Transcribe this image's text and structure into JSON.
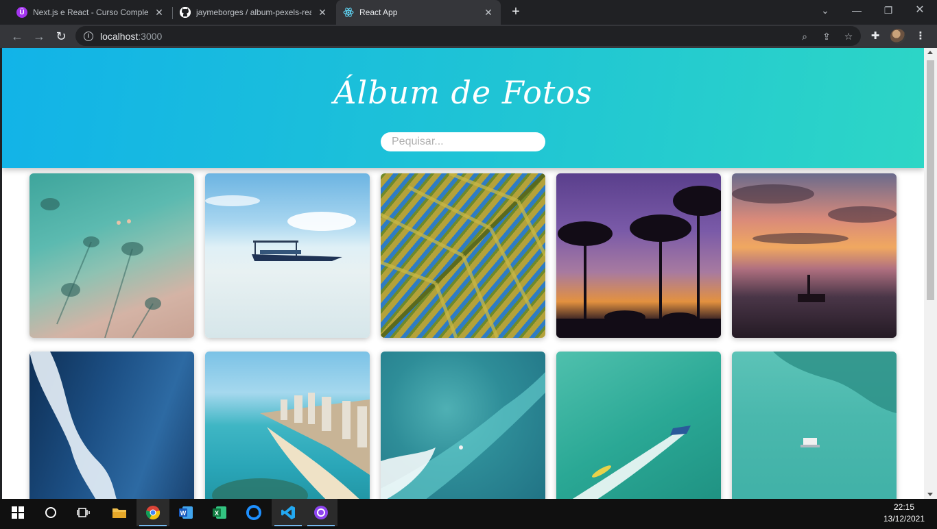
{
  "browser": {
    "tabs": [
      {
        "title": "Next.js e React - Curso Completo",
        "favicon": "udemy-icon",
        "color": "#a435f0"
      },
      {
        "title": "jaymeborges / album-pexels-react",
        "favicon": "github-icon",
        "color": "#ffffff"
      },
      {
        "title": "React App",
        "favicon": "react-icon",
        "color": "#61dafb"
      }
    ],
    "address": {
      "host": "localhost",
      "port": ":3000"
    }
  },
  "page": {
    "title": "Álbum de Fotos",
    "search_placeholder": "Pequisar...",
    "header_gradient": [
      "#12b3e8",
      "#2dd6c6"
    ],
    "photos": [
      {
        "subject": "aerial beach with palm shadows"
      },
      {
        "subject": "boat on shallow clear water"
      },
      {
        "subject": "palm leaf closeup"
      },
      {
        "subject": "palm silhouettes at purple sunset"
      },
      {
        "subject": "sunset over sea with pier"
      },
      {
        "subject": "aerial ocean wave"
      },
      {
        "subject": "aerial coastline city"
      },
      {
        "subject": "aerial turquoise sea surfer"
      },
      {
        "subject": "aerial speedboat wake"
      },
      {
        "subject": "aerial boat over reef"
      }
    ]
  },
  "taskbar": {
    "apps": [
      "windows-start-icon",
      "search-circle-icon",
      "task-view-icon",
      "file-explorer-icon",
      "chrome-icon",
      "word-icon",
      "excel-icon",
      "edge-icon",
      "vscode-icon",
      "github-desktop-icon"
    ],
    "time": "22:15",
    "date": "13/12/2021"
  }
}
